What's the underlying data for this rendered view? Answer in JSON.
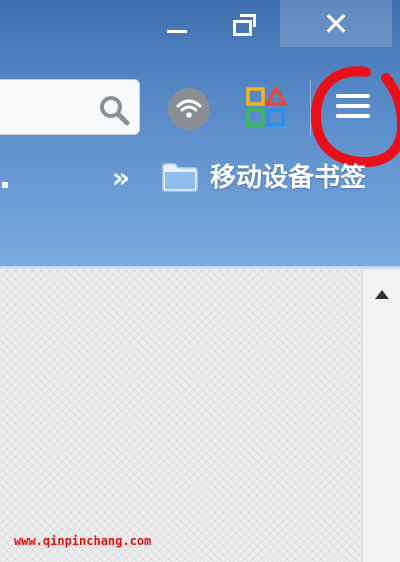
{
  "window_controls": {
    "minimize_icon": "minimize-icon",
    "restore_icon": "restore-icon",
    "close_icon": "close-icon",
    "close_glyph": "✕"
  },
  "toolbar": {
    "search_icon": "search-icon",
    "wifi_icon": "wifi-icon",
    "apps_icon": "apps-icon",
    "menu_icon": "hamburger-menu-icon",
    "menu_highlight_color": "#e8101a"
  },
  "bookmarks_bar": {
    "overflow_glyph": "»",
    "folder_icon": "folder-icon",
    "folder_label": "移动设备书签"
  },
  "watermark": "www.qinpinchang.com",
  "colors": {
    "chrome_top": "#3f6fae",
    "chrome_bottom": "#7aaade",
    "annotation_red": "#e8101a",
    "watermark_red": "#e01010"
  }
}
